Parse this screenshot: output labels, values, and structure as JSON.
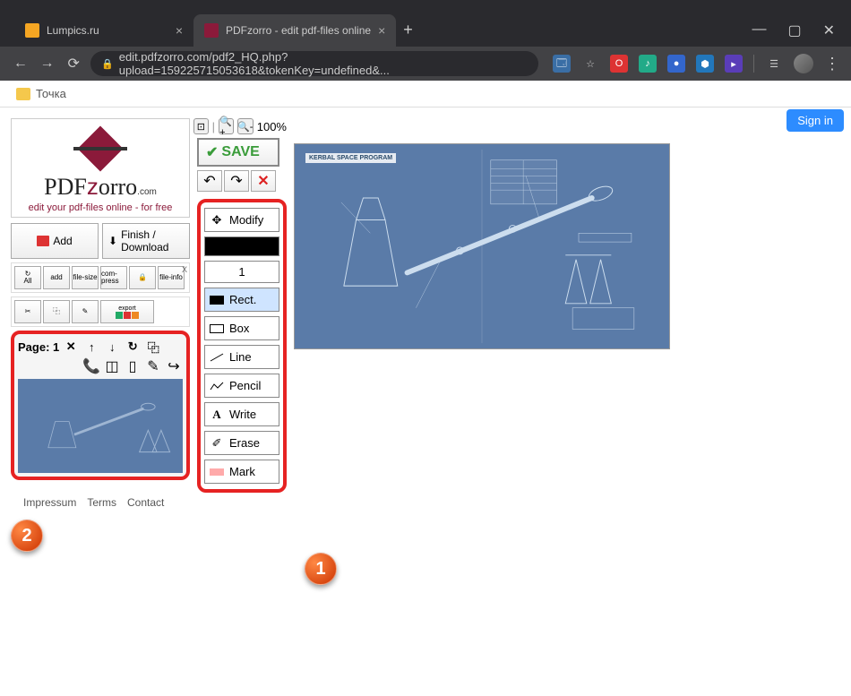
{
  "browser": {
    "tabs": [
      {
        "title": "Lumpics.ru",
        "active": false
      },
      {
        "title": "PDFzorro - edit pdf-files online",
        "active": true
      }
    ],
    "url": "edit.pdfzorro.com/pdf2_HQ.php?upload=159225715053618&tokenKey=undefined&...",
    "bookmark": "Точка"
  },
  "signin": "Sign in",
  "logo": {
    "name": "PDFzorro",
    "sub": "edit your pdf-files online - for free",
    "com": ".com"
  },
  "buttons": {
    "add": "Add",
    "finish": "Finish / Download"
  },
  "mini_tools": [
    "All",
    "add",
    "file-size",
    "com-press",
    "",
    "file-info"
  ],
  "export_label": "export",
  "page": {
    "label": "Page: 1"
  },
  "footer": {
    "impressum": "Impressum",
    "terms": "Terms",
    "contact": "Contact"
  },
  "zoom": {
    "level": "100%"
  },
  "save": "SAVE",
  "tools": {
    "modify": "Modify",
    "thickness": "1",
    "rect": "Rect.",
    "box": "Box",
    "line": "Line",
    "pencil": "Pencil",
    "write": "Write",
    "erase": "Erase",
    "mark": "Mark"
  },
  "blueprint": {
    "title": "KERBAL SPACE PROGRAM"
  },
  "callouts": {
    "one": "1",
    "two": "2"
  }
}
